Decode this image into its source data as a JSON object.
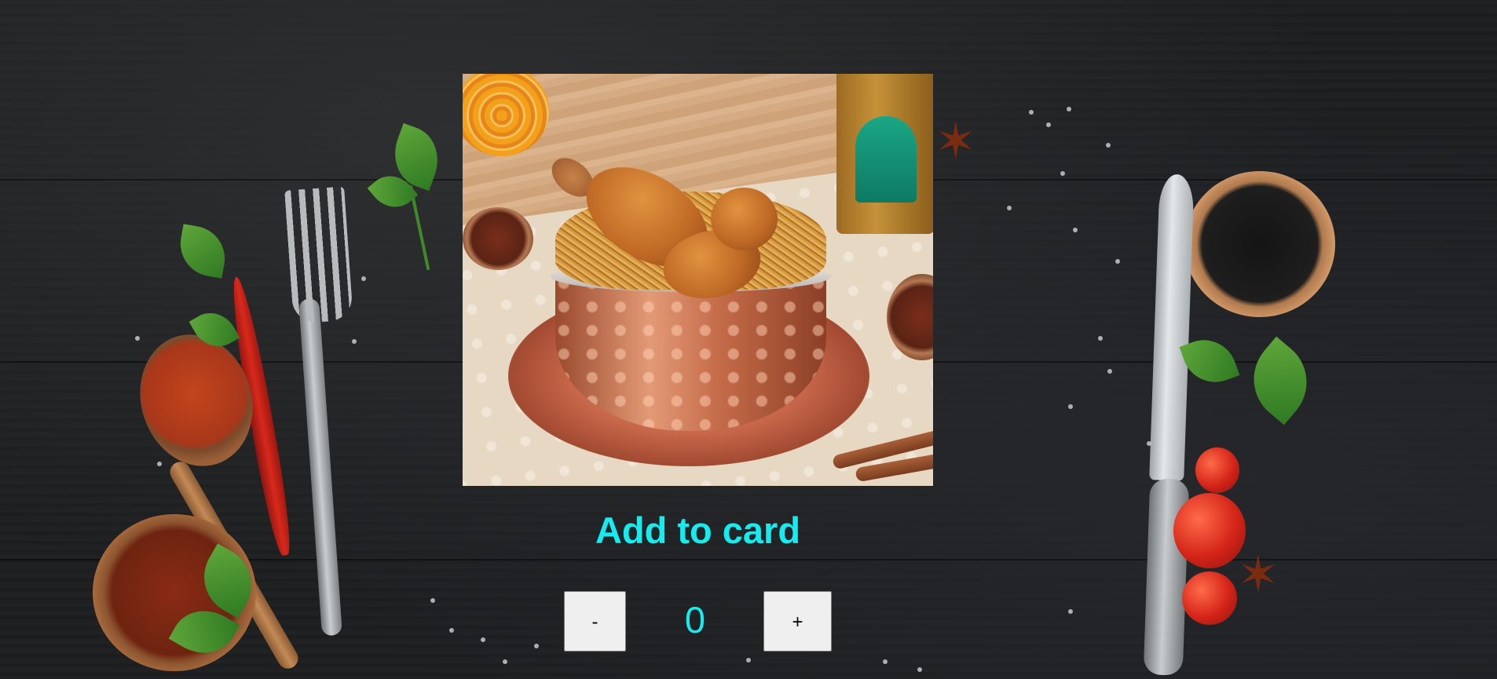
{
  "product": {
    "image_alt": "chicken biryani in copper bowl",
    "add_label": "Add to card"
  },
  "quantity": {
    "decrement_label": "-",
    "value": "0",
    "increment_label": "+"
  },
  "colors": {
    "accent": "#14ecf0",
    "background": "#1c1e20",
    "button": "#efefef"
  }
}
